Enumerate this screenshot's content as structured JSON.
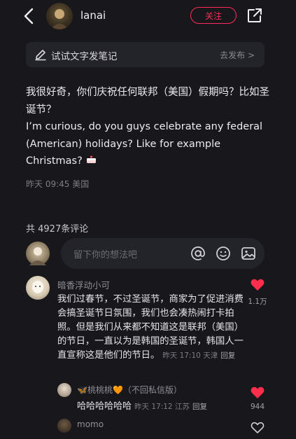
{
  "header": {
    "username": "lanai",
    "follow_label": "关注"
  },
  "draft": {
    "label": "试试文字发笔记",
    "action": "去发布 >"
  },
  "post": {
    "text_zh": "我很好奇，你们庆祝任何联邦（美国）假期吗？比如圣诞节？",
    "text_en": "I’m curious, do you guys celebrate any federal (American) holidays? Like for example Christmas?",
    "meta": "昨天 09:45 美国"
  },
  "comments_section": {
    "count_label": "共 4927条评论",
    "input_placeholder": "留下你的想法吧"
  },
  "comments": [
    {
      "author": "暗香浮动小可",
      "text": "我们过春节，不过圣诞节，商家为了促进消费会搞圣诞节日氛围，我们也会凑热闹打卡拍照。但是我们从来都不知道这是联邦（美国）的节日，一直以为是韩国的圣诞节，韩国人一直宣称这是他们的节日。",
      "meta": "昨天 17:10 天津",
      "reply_label": "回复",
      "likes": "1.1万",
      "liked": true
    }
  ],
  "reply": {
    "author": "🦋桃桃桃🧡（不回私信版）",
    "text": "哈哈哈哈哈哈",
    "meta": "昨天 17:12 江苏",
    "reply_label": "回复",
    "likes": "944",
    "liked": true
  },
  "next_comment": {
    "author": "momo"
  },
  "colors": {
    "background": "#17171c",
    "accent": "#ff2d55",
    "heart": "#ff2e4d"
  }
}
